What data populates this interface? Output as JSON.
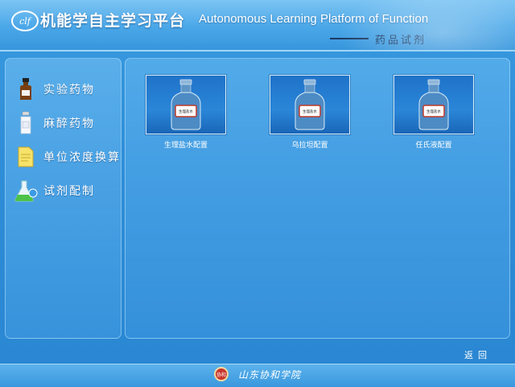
{
  "header": {
    "logo_text": "clf",
    "title_cn": "机能学自主学习平台",
    "title_en": "Autonomous Learning Platform of Function",
    "section": "药品试剂"
  },
  "sidebar": {
    "items": [
      {
        "label": "实验药物",
        "icon": "brown-bottle-icon"
      },
      {
        "label": "麻醉药物",
        "icon": "vial-icon"
      },
      {
        "label": "单位浓度换算",
        "icon": "document-icon"
      },
      {
        "label": "试剂配制",
        "icon": "flask-icon"
      }
    ]
  },
  "cards": [
    {
      "caption": "生理盐水配置",
      "bottle_label": "生理盐水"
    },
    {
      "caption": "乌拉坦配置",
      "bottle_label": "生理盐水"
    },
    {
      "caption": "任氏液配置",
      "bottle_label": "生理盐水"
    }
  ],
  "footer": {
    "back_label": "返回",
    "seal_text": "协和",
    "school_name": "山东协和学院"
  },
  "colors": {
    "background": "#2f8ed8",
    "header": "#4aa7e8",
    "section_text": "#1b3b66"
  }
}
